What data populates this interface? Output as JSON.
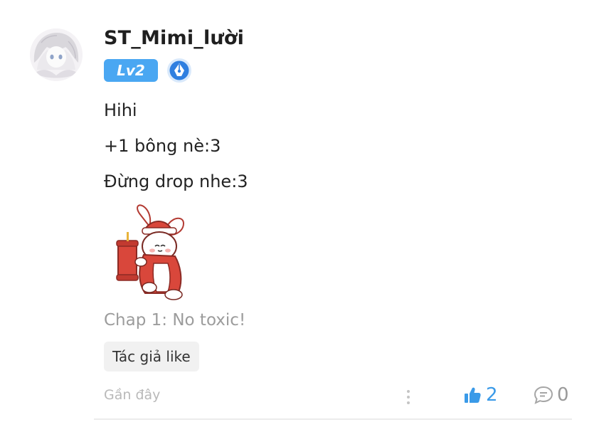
{
  "comment": {
    "username": "ST_Mimi_lười",
    "level": "Lv2",
    "lines": [
      "Hihi",
      "+1 bông nè:3",
      "Đừng drop nhe:3"
    ],
    "chapter": "Chap 1: No toxic!",
    "tag": "Tác giả like",
    "time": "Gần đây",
    "likes": "2",
    "comments": "0"
  },
  "colors": {
    "accent": "#3a9ae8",
    "level_badge": "#4aa7f2",
    "muted_text": "#9c9c9c"
  },
  "icons": [
    "avatar",
    "pen-badge-icon",
    "bunny-sticker",
    "more-options-icon",
    "thumbs-up-icon",
    "comment-bubble-icon"
  ]
}
